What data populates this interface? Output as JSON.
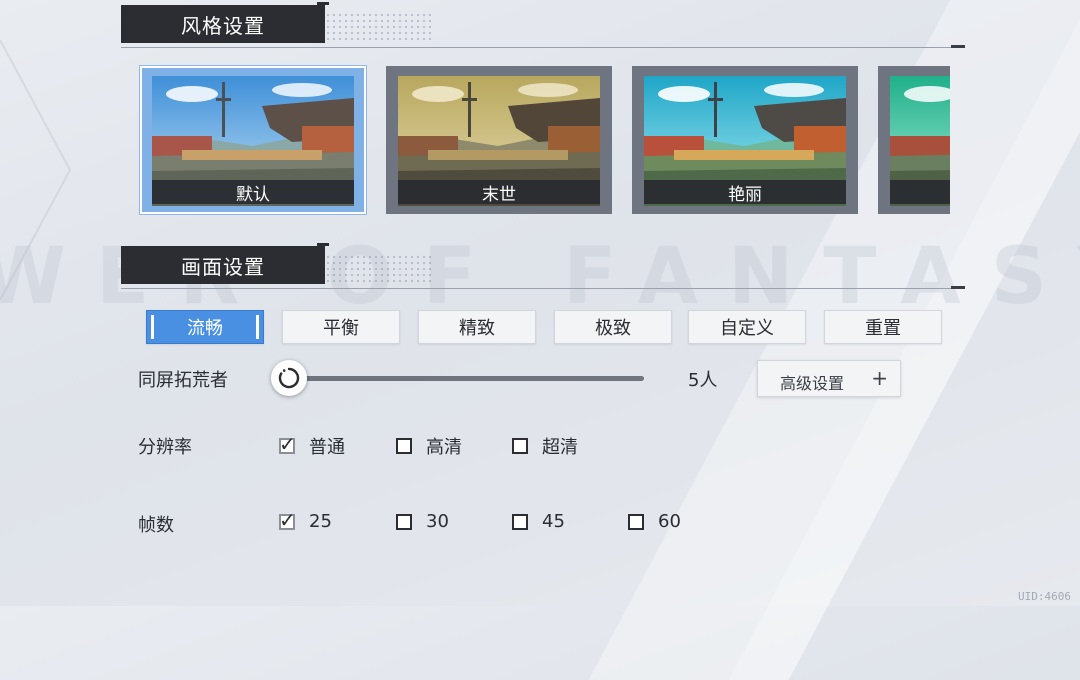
{
  "style_section": {
    "title": "风格设置",
    "presets": [
      {
        "label": "默认",
        "selected": true
      },
      {
        "label": "末世",
        "selected": false
      },
      {
        "label": "艳丽",
        "selected": false
      },
      {
        "label": "",
        "selected": false
      }
    ]
  },
  "graphics_section": {
    "title": "画面设置",
    "quality_tabs": [
      {
        "label": "流畅",
        "active": true
      },
      {
        "label": "平衡",
        "active": false
      },
      {
        "label": "精致",
        "active": false
      },
      {
        "label": "极致",
        "active": false
      },
      {
        "label": "自定义",
        "active": false
      },
      {
        "label": "重置",
        "active": false
      }
    ],
    "same_screen_players": {
      "label": "同屏拓荒者",
      "value_text": "5人",
      "slider_fraction": 0.0
    },
    "advanced_button": {
      "label": "高级设置",
      "icon": "plus-icon"
    },
    "resolution": {
      "label": "分辨率",
      "options": [
        {
          "label": "普通",
          "checked": true
        },
        {
          "label": "高清",
          "checked": false
        },
        {
          "label": "超清",
          "checked": false
        }
      ]
    },
    "frame_rate": {
      "label": "帧数",
      "options": [
        {
          "label": "25",
          "checked": true
        },
        {
          "label": "30",
          "checked": false
        },
        {
          "label": "45",
          "checked": false
        },
        {
          "label": "60",
          "checked": false
        }
      ]
    }
  },
  "watermark_text": "WER OF FANTASY",
  "uid_text": "UID:4606",
  "colors": {
    "accent": "#4a90e2",
    "header_bg": "#2b2d33",
    "selected_thumb_bg": "#7fb0e6"
  }
}
